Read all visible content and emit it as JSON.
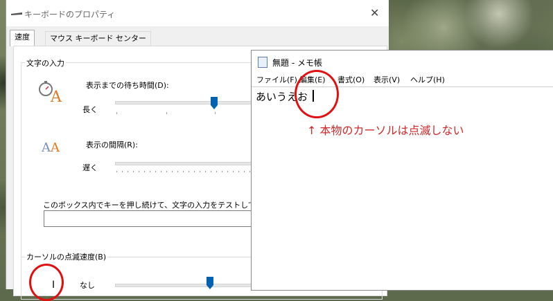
{
  "dialog": {
    "title": "キーボードのプロパティ",
    "close": "✕",
    "tabs": [
      {
        "label": "速度"
      },
      {
        "label": "マウス キーボード センター"
      }
    ],
    "repeat_group": {
      "label": "文字の入力",
      "delay_label": "表示までの待ち時間(D):",
      "delay_slow": "長く",
      "rate_label": "表示の間隔(R):",
      "rate_slow": "遅く",
      "test_label": "このボックス内でキーを押し続けて、文字の入力をテストしてください("
    },
    "cursor_group": {
      "label": "カーソルの点滅速度(B)",
      "none_label": "なし",
      "cursor_glyph": "I"
    },
    "delay_slider_fraction": 0.77,
    "cursor_slider_fraction": 0.67
  },
  "notepad": {
    "title": "無題 - メモ帳",
    "menu": [
      {
        "label": "ファイル(F)"
      },
      {
        "label": "編集(E)"
      },
      {
        "label": "書式(O)"
      },
      {
        "label": "表示(V)"
      },
      {
        "label": "ヘルプ(H)"
      }
    ],
    "content": "あいうえお",
    "annotation": "↑ 本物のカーソルは点滅しない"
  },
  "colors": {
    "annotation_red": "#d02828",
    "slider_thumb": "#0063b1"
  }
}
